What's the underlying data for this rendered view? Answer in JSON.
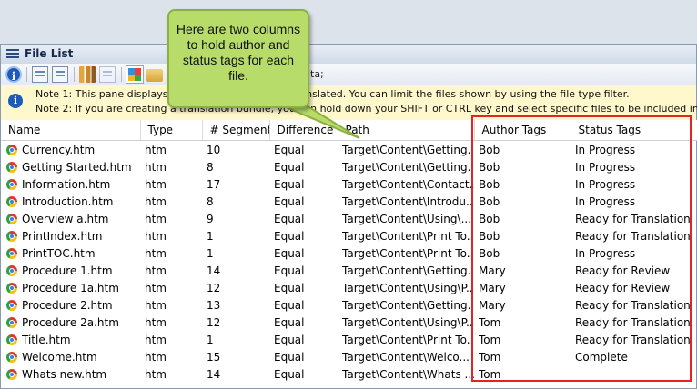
{
  "window": {
    "title": "File List"
  },
  "toolbar": {
    "buttons": [
      {
        "name": "info-button",
        "icon": "info-icon"
      },
      {
        "name": "edit-button",
        "icon": "edit-document-icon"
      },
      {
        "name": "search-doc-button",
        "icon": "search-document-icon"
      },
      {
        "name": "books-button",
        "icon": "books-icon"
      },
      {
        "name": "copy-button",
        "icon": "copy-icon"
      },
      {
        "name": "grid-button",
        "icon": "grid-icon"
      },
      {
        "name": "folder-button",
        "icon": "folder-icon"
      }
    ],
    "partial_text": "ta;"
  },
  "notes": {
    "line1": "Note 1: This pane displays a                                    translated. You can limit the files shown by using the file type filter.",
    "line2": "Note 2: If you are creating a translation bundle, you can hold down your SHIFT or CTRL key and select specific files to be included in the p"
  },
  "columns": [
    "Name",
    "Type",
    "# Segments",
    "Difference",
    "Path",
    "Author Tags",
    "Status Tags"
  ],
  "rows": [
    {
      "name": "Currency.htm",
      "type": "htm",
      "segments": "10",
      "difference": "Equal",
      "path": "Target\\Content\\Getting...",
      "author": "Bob",
      "status": "In Progress"
    },
    {
      "name": "Getting Started.htm",
      "type": "htm",
      "segments": "8",
      "difference": "Equal",
      "path": "Target\\Content\\Getting...",
      "author": "Bob",
      "status": "In Progress"
    },
    {
      "name": "Information.htm",
      "type": "htm",
      "segments": "17",
      "difference": "Equal",
      "path": "Target\\Content\\Contact...",
      "author": "Bob",
      "status": "In Progress"
    },
    {
      "name": "Introduction.htm",
      "type": "htm",
      "segments": "8",
      "difference": "Equal",
      "path": "Target\\Content\\Introdu...",
      "author": "Bob",
      "status": "In Progress"
    },
    {
      "name": "Overview a.htm",
      "type": "htm",
      "segments": "9",
      "difference": "Equal",
      "path": "Target\\Content\\Using\\...",
      "author": "Bob",
      "status": "Ready for Translation"
    },
    {
      "name": "PrintIndex.htm",
      "type": "htm",
      "segments": "1",
      "difference": "Equal",
      "path": "Target\\Content\\Print To...",
      "author": "Bob",
      "status": "Ready for Translation"
    },
    {
      "name": "PrintTOC.htm",
      "type": "htm",
      "segments": "1",
      "difference": "Equal",
      "path": "Target\\Content\\Print To...",
      "author": "Bob",
      "status": "In Progress"
    },
    {
      "name": "Procedure 1.htm",
      "type": "htm",
      "segments": "14",
      "difference": "Equal",
      "path": "Target\\Content\\Getting...",
      "author": "Mary",
      "status": "Ready for Review"
    },
    {
      "name": "Procedure 1a.htm",
      "type": "htm",
      "segments": "12",
      "difference": "Equal",
      "path": "Target\\Content\\Using\\P...",
      "author": "Mary",
      "status": "Ready for Review"
    },
    {
      "name": "Procedure 2.htm",
      "type": "htm",
      "segments": "13",
      "difference": "Equal",
      "path": "Target\\Content\\Getting...",
      "author": "Mary",
      "status": "Ready for Translation"
    },
    {
      "name": "Procedure 2a.htm",
      "type": "htm",
      "segments": "12",
      "difference": "Equal",
      "path": "Target\\Content\\Using\\P...",
      "author": "Tom",
      "status": "Ready for Translation"
    },
    {
      "name": "Title.htm",
      "type": "htm",
      "segments": "1",
      "difference": "Equal",
      "path": "Target\\Content\\Print To...",
      "author": "Tom",
      "status": "Ready for Translation"
    },
    {
      "name": "Welcome.htm",
      "type": "htm",
      "segments": "15",
      "difference": "Equal",
      "path": "Target\\Content\\Welco...",
      "author": "Tom",
      "status": "Complete"
    },
    {
      "name": "Whats new.htm",
      "type": "htm",
      "segments": "14",
      "difference": "Equal",
      "path": "Target\\Content\\Whats ...",
      "author": "Tom",
      "status": ""
    }
  ],
  "callout": {
    "text": "Here are two columns to hold author and status tags for each file."
  },
  "colors": {
    "highlight": "#e02525",
    "callout": "#b7dc6a",
    "note_bg": "#fff8cc"
  }
}
